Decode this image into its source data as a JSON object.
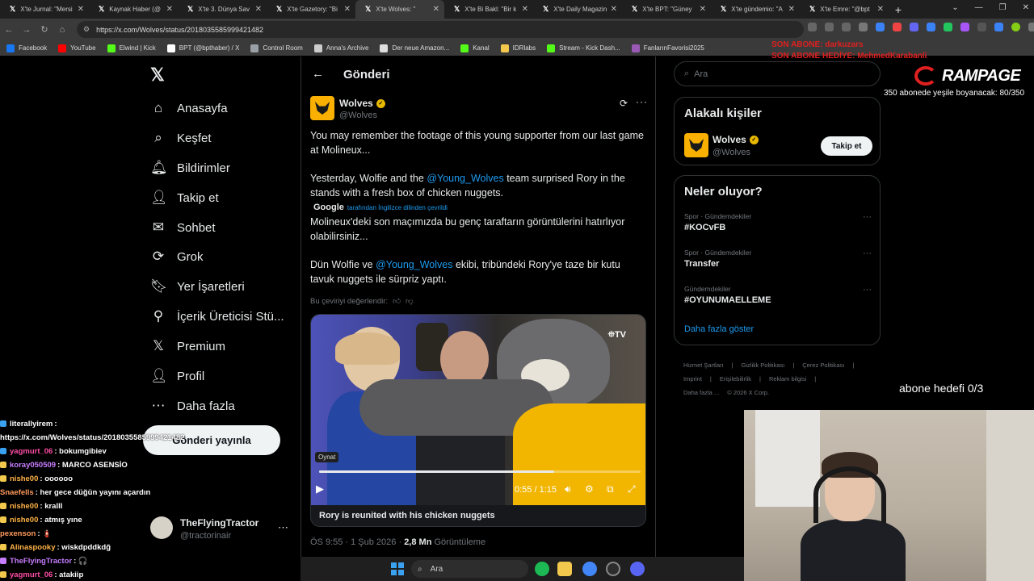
{
  "browser": {
    "tabs": [
      {
        "label": "X'te Jurnal: \"Mersi"
      },
      {
        "label": "Kaynak Haber (@"
      },
      {
        "label": "X'te 3. Dünya Sav"
      },
      {
        "label": "X'te Gazetory: \"Bi"
      },
      {
        "label": "X'te Wolves: \""
      },
      {
        "label": "X'te Bi Bakl: \"Bir k"
      },
      {
        "label": "X'te Daily Magazin"
      },
      {
        "label": "X'te BPT: \"Güney"
      },
      {
        "label": "X'te gündemio: \"A"
      },
      {
        "label": "X'te Emre: \"@bpt"
      }
    ],
    "url": "https://x.com/Wolves/status/2018035585999421482",
    "bookmarks": [
      {
        "label": "Facebook",
        "color": "#1877f2"
      },
      {
        "label": "YouTube",
        "color": "#ff0000"
      },
      {
        "label": "Elwind | Kick",
        "color": "#53fc18"
      },
      {
        "label": "BPT (@bpthaber) / X",
        "color": "#ffffff"
      },
      {
        "label": "Control Room",
        "color": "#9aa0a6"
      },
      {
        "label": "Anna's Archive",
        "color": "#cccccc"
      },
      {
        "label": "Der neue Amazon...",
        "color": "#dddddd"
      },
      {
        "label": "Kanal",
        "color": "#53fc18"
      },
      {
        "label": "IDRlabs",
        "color": "#f2c94c"
      },
      {
        "label": "Stream - Kick Dash...",
        "color": "#53fc18"
      },
      {
        "label": "FanlarınFavorisi2025",
        "color": "#9b59b6"
      }
    ]
  },
  "sidebar": {
    "logo": "𝕏",
    "items": [
      {
        "label": "Anasayfa",
        "icon": "⌂"
      },
      {
        "label": "Keşfet",
        "icon": "⌕"
      },
      {
        "label": "Bildirimler",
        "icon": "🔔︎"
      },
      {
        "label": "Takip et",
        "icon": "👤︎"
      },
      {
        "label": "Sohbet",
        "icon": "✉"
      },
      {
        "label": "Grok",
        "icon": "⟳"
      },
      {
        "label": "Yer İşaretleri",
        "icon": "🔖︎"
      },
      {
        "label": "İçerik Üreticisi Stü...",
        "icon": "⚲"
      },
      {
        "label": "Premium",
        "icon": "𝕏"
      },
      {
        "label": "Profil",
        "icon": "👤︎"
      },
      {
        "label": "Daha fazla",
        "icon": "⋯"
      }
    ],
    "post_button": "Gönderi yayınla",
    "account": {
      "name": "TheFlyingTractor",
      "handle": "@tractorinair",
      "more": "⋯"
    }
  },
  "main": {
    "title": "Gönderi",
    "post": {
      "author": "Wolves",
      "handle": "@Wolves",
      "text1": "You may remember the footage of this young supporter from our last game at Molineux...",
      "text2a": "Yesterday, Wolfie and the ",
      "mention": "@Young_Wolves",
      "text2b": " team surprised Rory in the stands with a fresh box of chicken nuggets.",
      "translated_by_brand": "Google",
      "translated_by": "tarafından İngilizce dilinden çevrildi",
      "tr1": "Molineux'deki son maçımızda bu genç taraftarın görüntülerini hatırlıyor olabilirsiniz...",
      "tr2a": "Dün Wolfie ve ",
      "tr2b": " ekibi, tribündeki Rory'ye taze bir kutu tavuk nuggets ile sürpriz yaptı.",
      "rate_translation": "Bu çeviriyi değerlendir:",
      "video": {
        "watermark": "⯐TV",
        "tooltip": "Oynat",
        "time": "0:55 / 1:15",
        "progress": 0.73,
        "caption": "Rory is reunited with his chicken nuggets"
      },
      "timestamp": "ÖS 9:55 · 1 Şub 2026 · ",
      "views": "2,8 Mn",
      "views_label": " Görüntüleme"
    }
  },
  "right": {
    "search_placeholder": "Ara",
    "related": {
      "title": "Alakalı kişiler",
      "name": "Wolves",
      "handle": "@Wolves",
      "follow": "Takip et"
    },
    "trends": {
      "title": "Neler oluyor?",
      "items": [
        {
          "category": "Spor · Gündemdekiler",
          "title": "#KOCvFB"
        },
        {
          "category": "Spor · Gündemdekiler",
          "title": "Transfer"
        },
        {
          "category": "Gündemdekiler",
          "title": "#OYUNUMAELLEME"
        }
      ],
      "show_more": "Daha fazla göster"
    },
    "footer": [
      "Hizmet Şartları",
      "|",
      "Gizlilik Politikası",
      "|",
      "Çerez Politikası",
      "|",
      "Imprint",
      "|",
      "Erişilebilirlik",
      "|",
      "Reklam bilgisi",
      "|",
      "Daha fazla ...",
      "© 2026 X Corp."
    ]
  },
  "overlay": {
    "son_abone": "SON ABONE: darkuzars",
    "son_abone_hediye": "SON ABONE HEDİYE: MehmedKarabanli",
    "brand": "RAMPAGE",
    "sub_goal": "350 abonede yeşile boyanacak: 80/350",
    "abone_hedefi": "abone hedefi 0/3"
  },
  "chat": [
    {
      "user": "literallyirem",
      "text": ":",
      "color": "#ffffff",
      "badge": "#3aa0f0"
    },
    {
      "user": "",
      "text": "https://x.com/Wolves/status/2018035585999421482",
      "color": "#ffffff",
      "badge": ""
    },
    {
      "user": "yagmurt_06",
      "text": ": bokumgibiev",
      "color": "#ff4da6",
      "badge": "#3aa0f0"
    },
    {
      "user": "koray050509",
      "text": ": MARCO ASENSİO",
      "color": "#c77dff",
      "badge": "#f2c94c"
    },
    {
      "user": "nishe00",
      "text": ": oooooo",
      "color": "#ffb347",
      "badge": "#f2c94c"
    },
    {
      "user": "Snaefells",
      "text": ": her gece düğün yayını açardın",
      "color": "#ff9a5c",
      "badge": ""
    },
    {
      "user": "nishe00",
      "text": ": kralll",
      "color": "#ffb347",
      "badge": "#f2c94c"
    },
    {
      "user": "nishe00",
      "text": ": atmış yıne",
      "color": "#ffb347",
      "badge": "#f2c94c"
    },
    {
      "user": "pexenson",
      "text": ": 🧯",
      "color": "#ff9a5c",
      "badge": ""
    },
    {
      "user": "Alinaspooky",
      "text": ": wiskdpddkdğ",
      "color": "#ffb347",
      "badge": "#f2c94c"
    },
    {
      "user": "TheFlyingTractor",
      "text": ": 🎧",
      "color": "#c77dff",
      "badge": "#c77dff"
    },
    {
      "user": "yagmurt_06",
      "text": ": atakiip",
      "color": "#ff4da6",
      "badge": "#f2c94c"
    }
  ],
  "taskbar": {
    "search": "Ara"
  }
}
